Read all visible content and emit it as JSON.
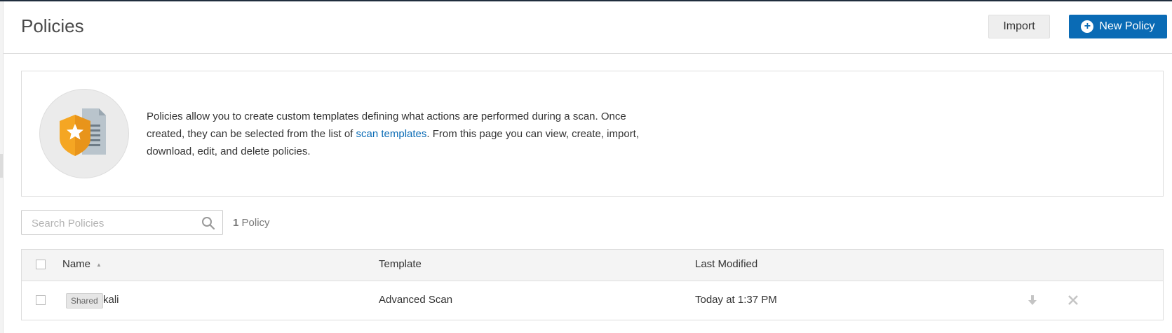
{
  "header": {
    "title": "Policies",
    "import_label": "Import",
    "new_policy_label": "New Policy"
  },
  "info": {
    "text_before_link": "Policies allow you to create custom templates defining what actions are performed during a scan. Once created, they can be selected from the list of ",
    "link_text": "scan templates",
    "text_after_link": ". From this page you can view, create, import, download, edit, and delete policies.",
    "illustration_icon": "policy-document-shield-star-icon"
  },
  "search": {
    "placeholder": "Search Policies",
    "value": ""
  },
  "count": {
    "number": "1",
    "label": "Policy"
  },
  "table": {
    "columns": [
      "Name",
      "Template",
      "Last Modified"
    ],
    "sort_column": "Name",
    "sort_direction": "asc",
    "rows": [
      {
        "badge": "Shared",
        "name": "kali",
        "template": "Advanced Scan",
        "last_modified": "Today at 1:37 PM",
        "actions": [
          "download-icon",
          "close-icon"
        ]
      }
    ]
  },
  "colors": {
    "primary": "#0a6bb5",
    "shield": "#f5a623",
    "document": "#b9c4cc"
  }
}
